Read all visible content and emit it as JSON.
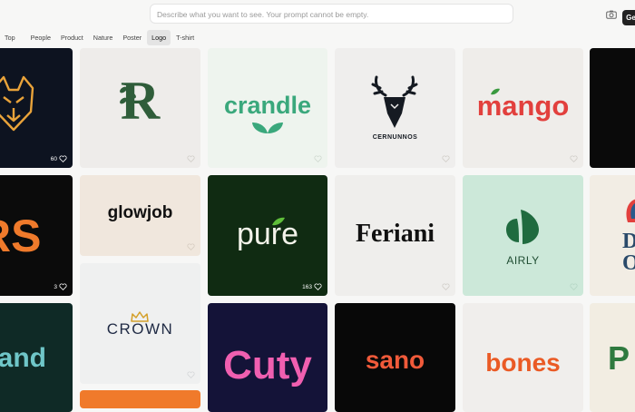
{
  "search": {
    "placeholder": "Describe what you want to see. Your prompt cannot be empty.",
    "value": "",
    "camera_icon": "camera-icon",
    "generate_label": "Generate"
  },
  "tabs": [
    {
      "label": "Top",
      "active": false
    },
    {
      "label": "People",
      "active": false
    },
    {
      "label": "Product",
      "active": false
    },
    {
      "label": "Nature",
      "active": false
    },
    {
      "label": "Poster",
      "active": false
    },
    {
      "label": "Logo",
      "active": true
    },
    {
      "label": "T-shirt",
      "active": false
    }
  ],
  "gallery": {
    "r1c0": {
      "likes": "60"
    },
    "r1c1": {
      "logo": "R"
    },
    "r1c2": {
      "logo": "crandle"
    },
    "r1c3": {
      "logo": "CERNUNNOS"
    },
    "r1c4": {
      "logo": "mango"
    },
    "r2c0": {
      "logo": "RS",
      "likes": "3"
    },
    "r2c1": {
      "logo": "glowjob"
    },
    "r2c2": {
      "logo": "pure",
      "likes": "163"
    },
    "r2c3": {
      "logo": "Feriani"
    },
    "r2c4": {
      "logo": "AIRLY"
    },
    "r3c0": {
      "logo": "rand"
    },
    "r3c1": {
      "logo": "CROWN"
    },
    "r3c2": {
      "logo": "Cuty"
    },
    "r3c3": {
      "logo": "sano"
    },
    "r3c4": {
      "logo": "bones"
    }
  }
}
